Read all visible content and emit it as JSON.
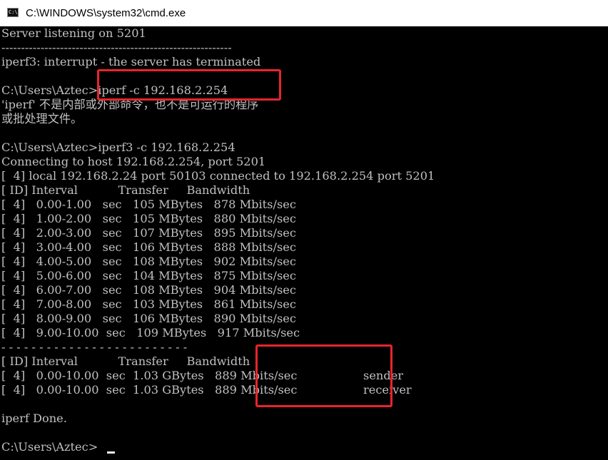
{
  "window": {
    "title": "C:\\WINDOWS\\system32\\cmd.exe",
    "icon_text": "C:\\."
  },
  "console": {
    "lines": [
      "Server listening on 5201",
      "-----------------------------------------------------------",
      "iperf3: interrupt - the server has terminated",
      "",
      "C:\\Users\\Aztec>iperf -c 192.168.2.254",
      "'iperf' 不是内部或外部命令，也不是可运行的程序",
      "或批处理文件。",
      "",
      "C:\\Users\\Aztec>iperf3 -c 192.168.2.254",
      "Connecting to host 192.168.2.254, port 5201",
      "[  4] local 192.168.2.24 port 50103 connected to 192.168.2.254 port 5201",
      "[ ID] Interval           Transfer     Bandwidth",
      "[  4]   0.00-1.00   sec   105 MBytes   878 Mbits/sec",
      "[  4]   1.00-2.00   sec   105 MBytes   880 Mbits/sec",
      "[  4]   2.00-3.00   sec   107 MBytes   895 Mbits/sec",
      "[  4]   3.00-4.00   sec   106 MBytes   888 Mbits/sec",
      "[  4]   4.00-5.00   sec   108 MBytes   902 Mbits/sec",
      "[  4]   5.00-6.00   sec   104 MBytes   875 Mbits/sec",
      "[  4]   6.00-7.00   sec   108 MBytes   904 Mbits/sec",
      "[  4]   7.00-8.00   sec   103 MBytes   861 Mbits/sec",
      "[  4]   8.00-9.00   sec   106 MBytes   890 Mbits/sec",
      "[  4]   9.00-10.00  sec   109 MBytes   917 Mbits/sec",
      "- - - - - - - - - - - - - - - - - - - - - - - - -",
      "[ ID] Interval           Transfer     Bandwidth",
      "[  4]   0.00-10.00  sec  1.03 GBytes   889 Mbits/sec                  sender",
      "[  4]   0.00-10.00  sec  1.03 GBytes   889 Mbits/sec                  receiver",
      "",
      "iperf Done.",
      "",
      "C:\\Users\\Aztec>"
    ]
  },
  "colors": {
    "console_bg": "#000000",
    "console_text": "#c0c0c0",
    "highlight_border": "#e8242c"
  }
}
